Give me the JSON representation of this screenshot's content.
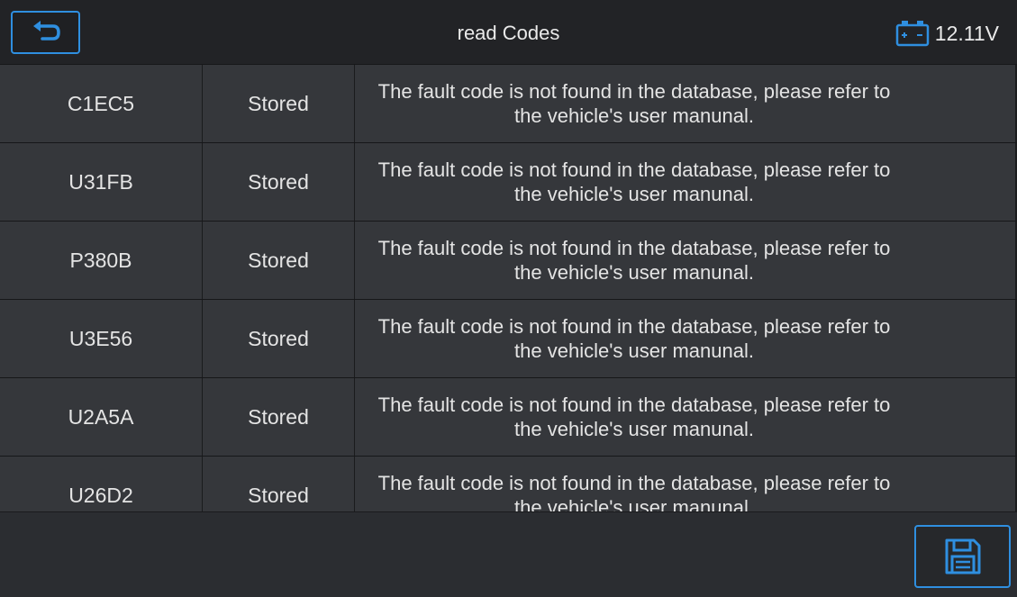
{
  "header": {
    "title": "read Codes",
    "voltage": "12.11V",
    "back_icon": "back-arrow-icon",
    "battery_icon": "battery-icon"
  },
  "rows": [
    {
      "code": "C1EC5",
      "status": "Stored",
      "description": "The fault code is not found in the database, please refer to the vehicle's user manunal."
    },
    {
      "code": "U31FB",
      "status": "Stored",
      "description": "The fault code is not found in the database, please refer to the vehicle's user manunal."
    },
    {
      "code": "P380B",
      "status": "Stored",
      "description": "The fault code is not found in the database, please refer to the vehicle's user manunal."
    },
    {
      "code": "U3E56",
      "status": "Stored",
      "description": "The fault code is not found in the database, please refer to the vehicle's user manunal."
    },
    {
      "code": "U2A5A",
      "status": "Stored",
      "description": "The fault code is not found in the database, please refer to the vehicle's user manunal."
    },
    {
      "code": "U26D2",
      "status": "Stored",
      "description": "The fault code is not found in the database, please refer to the vehicle's user manunal."
    }
  ],
  "footer": {
    "save_icon": "save-icon"
  },
  "colors": {
    "accent": "#2f8fe0",
    "row_bg": "#35373b",
    "header_bg": "#222326"
  }
}
